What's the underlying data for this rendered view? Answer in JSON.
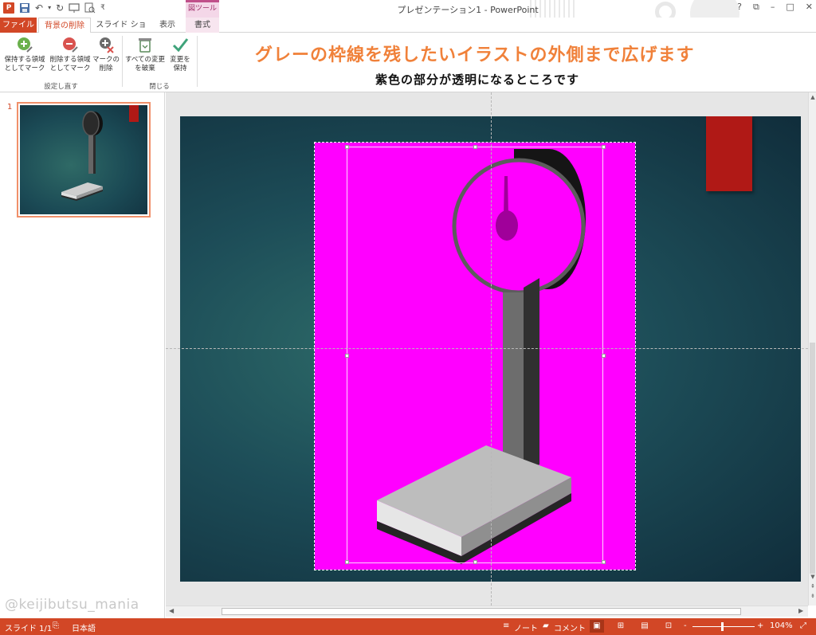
{
  "window": {
    "title": "プレゼンテーション1 - PowerPoint",
    "context_tab_group": "図ツール",
    "controls": [
      "?",
      "⧉",
      "–",
      "□",
      "✕"
    ]
  },
  "qat": {
    "app_icon": "P",
    "undo": "↶",
    "redo": "↻"
  },
  "tabs": {
    "file": "ファイル",
    "background_removal": "背景の削除",
    "slideshow": "スライド ショー",
    "view": "表示",
    "format": "書式"
  },
  "ribbon": {
    "keep_line1": "保持する領域",
    "keep_line2": "としてマーク",
    "remove_line1": "削除する領域",
    "remove_line2": "としてマーク",
    "delete_mark_line1": "マークの",
    "delete_mark_line2": "削除",
    "group_refine": "設定し直す",
    "discard_line1": "すべての変更",
    "discard_line2": "を破棄",
    "keep_changes_line1": "変更を",
    "keep_changes_line2": "保持",
    "group_close": "閉じる"
  },
  "annotation": {
    "headline": "グレーの枠線を残したいイラストの外側まで広げます",
    "subline": "紫色の部分が透明になるところです"
  },
  "thumbnails": {
    "slide_number": "1"
  },
  "watermark": "@keijibutsu_mania",
  "statusbar": {
    "slide_info": "スライド 1/1",
    "language": "日本語",
    "notes": "ノート",
    "comments": "コメント",
    "zoom_minus": "-",
    "zoom_plus": "+",
    "zoom_level": "104%"
  },
  "colors": {
    "accent": "#d24726",
    "annotation_orange": "#f0813a",
    "removal_magenta": "#ff00ff",
    "slide_bg": "#1d4d58",
    "red_block": "#b01916"
  }
}
